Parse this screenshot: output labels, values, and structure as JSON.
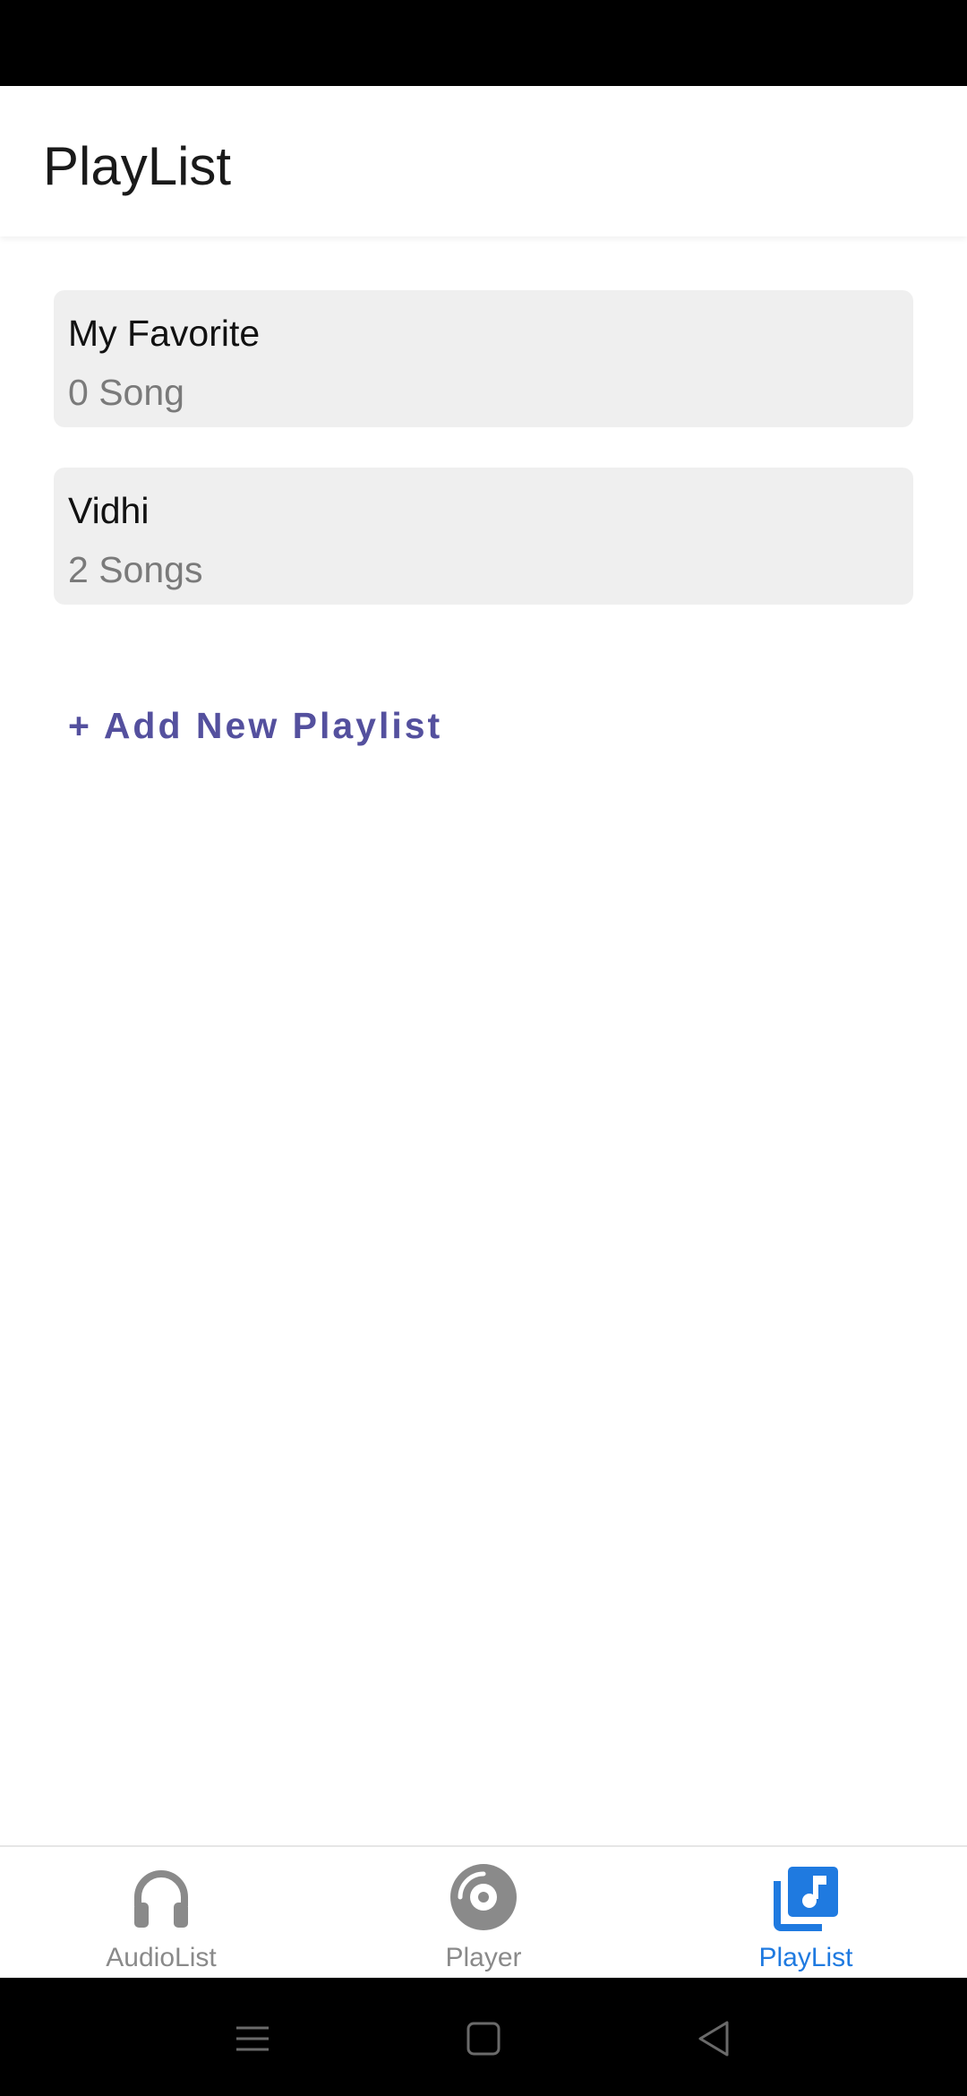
{
  "header": {
    "title": "PlayList"
  },
  "playlists": [
    {
      "name": "My Favorite",
      "count": "0 Song"
    },
    {
      "name": "Vidhi",
      "count": "2 Songs"
    }
  ],
  "add_playlist_label": "+ Add New Playlist",
  "bottom_nav": {
    "items": [
      {
        "label": "AudioList",
        "icon": "headphones-icon",
        "active": false
      },
      {
        "label": "Player",
        "icon": "disc-icon",
        "active": false
      },
      {
        "label": "PlayList",
        "icon": "music-library-icon",
        "active": true
      }
    ]
  },
  "colors": {
    "accent": "#54509e",
    "active_tab": "#1f7ae0",
    "inactive_tab": "#8a8a8a",
    "card_bg": "#efefef"
  },
  "system_nav": {
    "icons": [
      "menu-icon",
      "home-icon",
      "back-icon"
    ]
  }
}
